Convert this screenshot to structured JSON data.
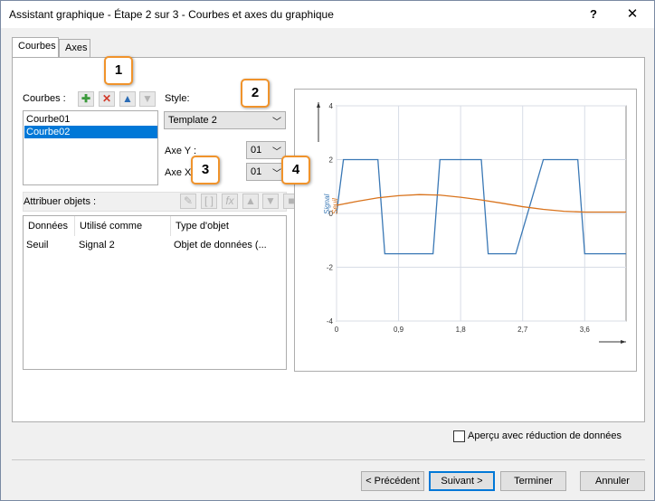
{
  "window": {
    "title": "Assistant graphique - Étape 2 sur 3 - Courbes et axes du graphique",
    "help": "?",
    "close": "✕"
  },
  "tabs": [
    {
      "label": "Courbes"
    },
    {
      "label": "Axes"
    }
  ],
  "courbes": {
    "label": "Courbes :",
    "items": [
      "Courbe01",
      "Courbe02"
    ]
  },
  "style": {
    "label": "Style:",
    "value": "Template 2"
  },
  "axe_y": {
    "label": "Axe Y :",
    "value": "01"
  },
  "axe_x": {
    "label": "Axe X :",
    "value": "01"
  },
  "attribuer": {
    "label": "Attribuer objets :"
  },
  "table": {
    "headers": [
      "Données",
      "Utilisé comme",
      "Type d'objet"
    ],
    "rows": [
      [
        "Seuil",
        "Signal 2",
        "Objet de données (..."
      ]
    ]
  },
  "badges": [
    "1",
    "2",
    "3",
    "4"
  ],
  "chart_data": {
    "type": "line",
    "xlim": [
      0,
      4.2
    ],
    "ylim": [
      -4,
      4
    ],
    "x_ticks": [
      "0",
      "0,9",
      "1,8",
      "2,7",
      "3,6"
    ],
    "y_ticks": [
      "4",
      "2",
      "0",
      "-2",
      "-4"
    ],
    "ylabels": [
      {
        "text": "Signal",
        "color": "#3a78b5"
      },
      {
        "text": "Seuil",
        "color": "#d9731c"
      }
    ],
    "series": [
      {
        "color": "#3a78b5",
        "x": [
          0,
          0.1,
          0.4,
          0.6,
          0.7,
          1.1,
          1.4,
          1.5,
          1.9,
          2.1,
          2.2,
          2.6,
          3.0,
          3.1,
          3.5,
          3.6,
          3.7,
          4.2
        ],
        "values": [
          0,
          2,
          2,
          2,
          -1.5,
          -1.5,
          -1.5,
          2,
          2,
          2,
          -1.5,
          -1.5,
          2,
          2,
          2,
          -1.5,
          -1.5,
          -1.5
        ]
      },
      {
        "color": "#d9731c",
        "x": [
          0,
          0.3,
          0.6,
          0.9,
          1.2,
          1.5,
          1.8,
          2.1,
          2.4,
          2.7,
          3.0,
          3.3,
          3.6,
          3.9,
          4.2
        ],
        "values": [
          0.3,
          0.45,
          0.58,
          0.66,
          0.7,
          0.68,
          0.6,
          0.5,
          0.38,
          0.25,
          0.15,
          0.08,
          0.05,
          0.05,
          0.05
        ]
      }
    ]
  },
  "apercu": {
    "label": "Aperçu avec réduction de données"
  },
  "buttons": {
    "precedent": "< Précédent",
    "suivant": "Suivant >",
    "terminer": "Terminer",
    "annuler": "Annuler"
  }
}
